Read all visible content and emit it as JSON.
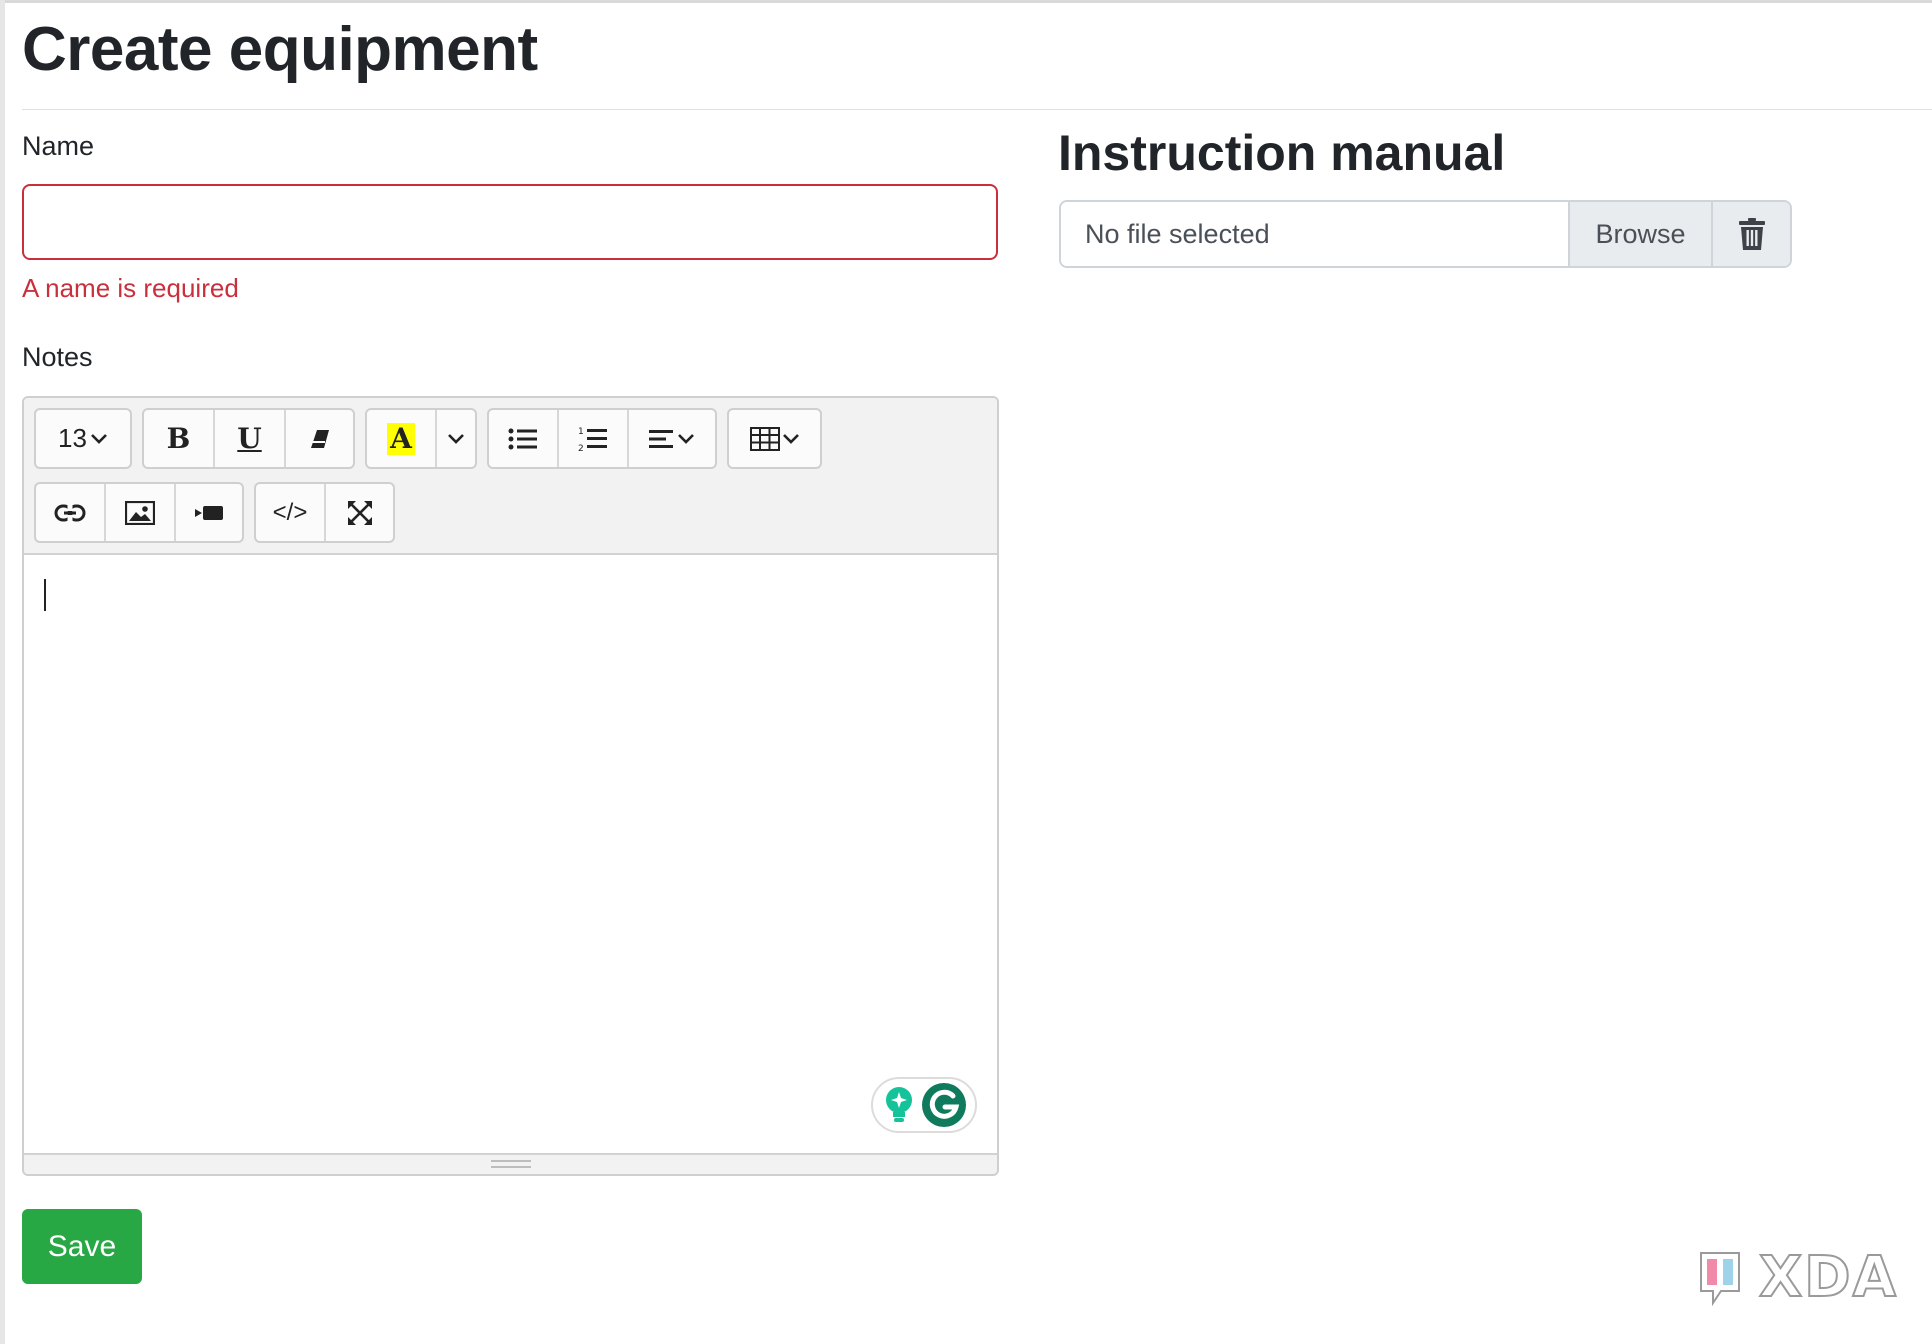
{
  "page": {
    "title": "Create equipment"
  },
  "form": {
    "name_label": "Name",
    "name_value": "",
    "name_error": "A name is required",
    "notes_label": "Notes",
    "save_label": "Save"
  },
  "editor": {
    "font_size": "13",
    "toolbar_row1": [
      "font-size-dropdown",
      "bold",
      "underline",
      "clear-format",
      "highlight-color",
      "color-dropdown",
      "unordered-list",
      "ordered-list",
      "paragraph-align",
      "table"
    ],
    "toolbar_row2": [
      "link",
      "image",
      "video",
      "code-view",
      "fullscreen"
    ],
    "bold_glyph": "B",
    "underline_glyph": "U",
    "highlight_glyph": "A",
    "code_glyph": "</>",
    "highlight_color": "#ffff00"
  },
  "manual": {
    "title": "Instruction manual",
    "file_text": "No file selected",
    "browse_label": "Browse"
  },
  "watermark": {
    "text": "XDA"
  },
  "colors": {
    "error": "#c9303e",
    "save": "#28a745",
    "grammarly": "#15c39a"
  }
}
